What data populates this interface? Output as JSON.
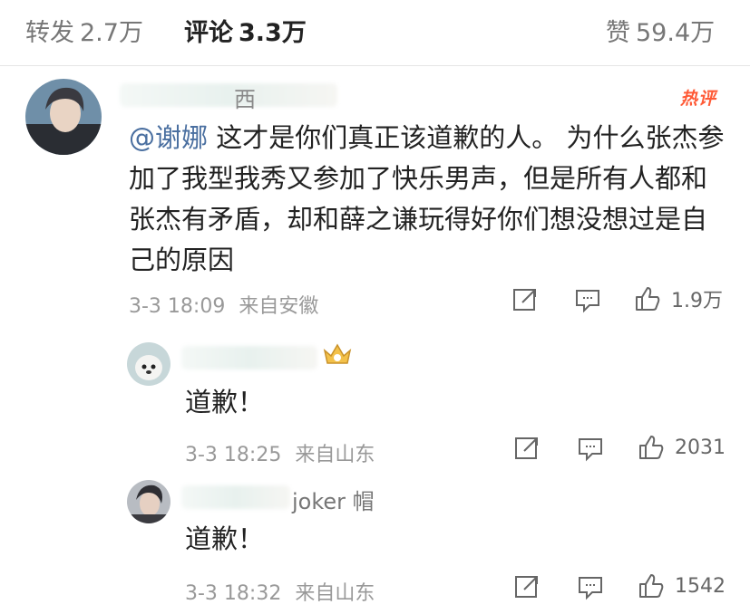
{
  "tabs": {
    "repost": {
      "label": "转发",
      "count": "2.7万"
    },
    "comment": {
      "label": "评论",
      "count": "3.3万"
    },
    "like": {
      "label": "赞",
      "count": "59.4万"
    }
  },
  "comment": {
    "name_visible": "西",
    "hot_label": "热评",
    "mention": "@谢娜",
    "text": " 这才是你们真正该道歉的人。 为什么张杰参加了我型我秀又参加了快乐男声，但是所有人都和张杰有矛盾，却和薛之谦玩得好你们想没想过是自己的原因",
    "time": "3-3 18:09",
    "source": "来自安徽",
    "like_count": "1.9万"
  },
  "replies": [
    {
      "name_visible": "",
      "text": "道歉！",
      "time": "3-3 18:25",
      "source": "来自山东",
      "like_count": "2031"
    },
    {
      "name_visible": "joker 帽",
      "text": "道歉！",
      "time": "3-3 18:32",
      "source": "来自山东",
      "like_count": "1542"
    }
  ],
  "icons": [
    "share-icon",
    "reply-icon",
    "like-icon",
    "crown-badge-icon"
  ]
}
